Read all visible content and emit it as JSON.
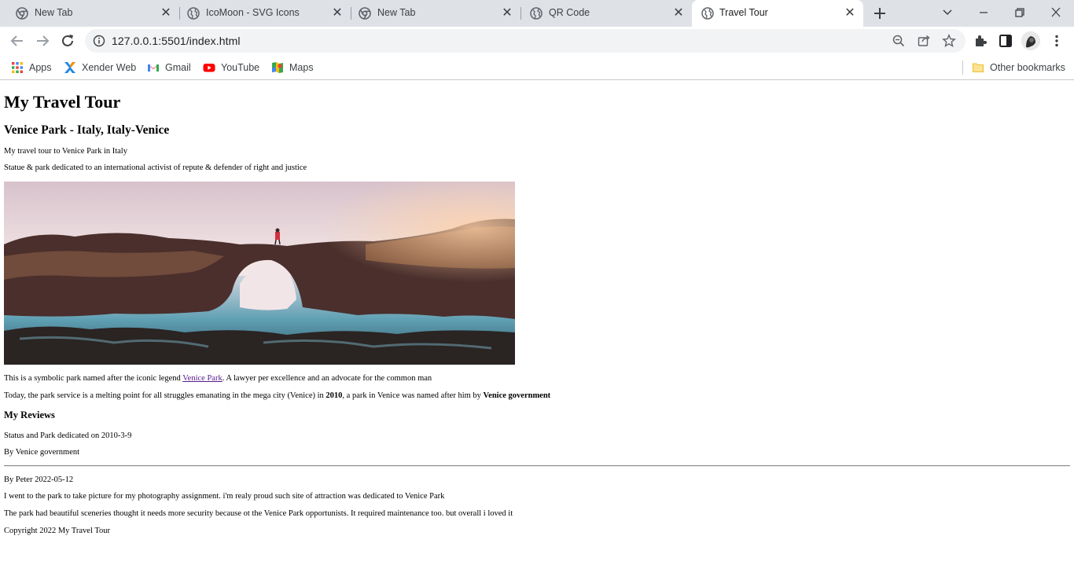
{
  "tabs": [
    {
      "title": "New Tab",
      "icon": "chrome-icon"
    },
    {
      "title": "IcoMoon - SVG Icons",
      "icon": "globe-icon"
    },
    {
      "title": "New Tab",
      "icon": "chrome-icon"
    },
    {
      "title": "QR Code",
      "icon": "globe-icon"
    },
    {
      "title": "Travel Tour",
      "icon": "globe-icon",
      "active": true
    }
  ],
  "toolbar": {
    "url": "127.0.0.1:5501/index.html"
  },
  "bookmarks": [
    {
      "label": "Apps",
      "icon": "apps-grid-icon"
    },
    {
      "label": "Xender Web",
      "icon": "xender-icon"
    },
    {
      "label": "Gmail",
      "icon": "gmail-icon"
    },
    {
      "label": "YouTube",
      "icon": "youtube-icon"
    },
    {
      "label": "Maps",
      "icon": "maps-icon"
    }
  ],
  "other_bookmarks": "Other bookmarks",
  "page": {
    "title": "My Travel Tour",
    "subtitle": "Venice Park - Italy, Italy-Venice",
    "intro": "My travel tour to Venice Park in Italy",
    "statue": "Statue & park dedicated to an international activist of repute & defender of right and justice",
    "symbolic_pre": "This is a symbolic park named after the iconic legend ",
    "symbolic_link": "Venice Park",
    "symbolic_post": ". A lawyer per excellence and an advocate for the common man",
    "today_pre": "Today, the park service is a melting point for all struggles emanating in the mega city (Venice) in ",
    "today_year": "2010",
    "today_mid": ", a park in Venice was named after him by ",
    "today_gov": "Venice government",
    "reviews_heading": "My Reviews",
    "dedicated": "Status and Park dedicated on 2010-3-9",
    "by_gov": "By Venice government",
    "review_author": "By Peter 2022-05-12",
    "review_1": "I went to the park to take picture for my photography assignment. i'm realy proud such site of attraction was dedicated to Venice Park",
    "review_2": "The park had beautiful sceneries thought it needs more security because ot the Venice Park opportunists. It required maintenance too. but overall i loved it",
    "copyright": "Copyright 2022 My Travel Tour"
  },
  "colors": {
    "tabstrip": "#dee1e6",
    "omnibox": "#f1f3f4",
    "link_visited": "#551a8b"
  }
}
